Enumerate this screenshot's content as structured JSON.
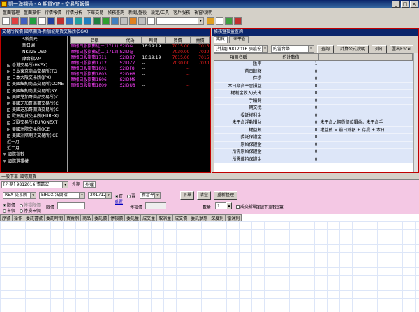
{
  "window": {
    "title": "凱一海期通 - A 期貨VIP - 交易所報價"
  },
  "menu": [
    "盤面管理",
    "盤面操作",
    "行情報價",
    "行情分析",
    "下單交易",
    "帳務查詢",
    "新聞/盤後",
    "設定/工具",
    "客戶服務",
    "視窗/說明"
  ],
  "left_panel": {
    "title": "交易所報價 國際期貨-新加坡期貨交易所(SGX)",
    "tree": [
      {
        "label": "S新美元",
        "level": 2,
        "expander": ""
      },
      {
        "label": "新日圓",
        "level": 2,
        "expander": ""
      },
      {
        "label": "NK225 USD",
        "level": 2,
        "expander": ""
      },
      {
        "label": "摩台指AM",
        "level": 2,
        "expander": ""
      },
      {
        "label": "香港交易所(HKEX)",
        "level": 1,
        "expander": "+"
      },
      {
        "label": "日本東京商品交易所(TO",
        "level": 1,
        "expander": "+"
      },
      {
        "label": "日本大阪交易所(JPX)",
        "level": 1,
        "expander": "+"
      },
      {
        "label": "美國紐約商品交易所(COME",
        "level": 1,
        "expander": "+"
      },
      {
        "label": "美國紐約商業交易所(NY",
        "level": 1,
        "expander": "+"
      },
      {
        "label": "美國芝加哥商品交易所(C",
        "level": 1,
        "expander": "+"
      },
      {
        "label": "美國芝加哥商業交易所(C",
        "level": 1,
        "expander": "+"
      },
      {
        "label": "美國芝加哥期貨交易所(C",
        "level": 1,
        "expander": "+"
      },
      {
        "label": "歐洲期貨交易所(EUREX)",
        "level": 1,
        "expander": "+"
      },
      {
        "label": "泛歐交易所(EURONEXT",
        "level": 1,
        "expander": "+"
      },
      {
        "label": "美國洲際交易所(ICE",
        "level": 1,
        "expander": "+"
      },
      {
        "label": "美國洲際期貨交易所(ICE",
        "level": 1,
        "expander": "+"
      },
      {
        "label": "近一月",
        "level": 1,
        "expander": ""
      },
      {
        "label": "近二月",
        "level": 1,
        "expander": ""
      },
      {
        "label": "國際指數",
        "level": 0,
        "expander": "+"
      },
      {
        "label": "國際選擇權",
        "level": 0,
        "expander": "+"
      }
    ],
    "columns": [
      "名稱",
      "代碼",
      "時間",
      "買價",
      "賣價"
    ],
    "rows": [
      {
        "name": "摩根日股指數近一(1711)",
        "code": "S2ID&",
        "time": "16:19:19",
        "buy": "7015.00",
        "sell": "7015"
      },
      {
        "name": "摩根日股指數近二(1712)",
        "code": "S2ID@",
        "time": "--",
        "buy": "7030.00",
        "sell": "7030"
      },
      {
        "name": "摩根日股指數1711",
        "code": "S2IDX7",
        "time": "16:19:19",
        "buy": "7015.00",
        "sell": "7015"
      },
      {
        "name": "摩根日股指數1712",
        "code": "S2IDZ7",
        "time": "--",
        "buy": "7030.00",
        "sell": "7030"
      },
      {
        "name": "摩根日股指數1801",
        "code": "S2IDF8",
        "time": "--",
        "buy": "--",
        "sell": ""
      },
      {
        "name": "摩根日股指數1803",
        "code": "S2IDH8",
        "time": "--",
        "buy": "--",
        "sell": ""
      },
      {
        "name": "摩根日股指數1806",
        "code": "S2IDM8",
        "time": "--",
        "buy": "--",
        "sell": ""
      },
      {
        "name": "摩根日股指數1809",
        "code": "S2IDU8",
        "time": "--",
        "buy": "--",
        "sell": ""
      }
    ]
  },
  "right_panel": {
    "title": "帳務暨損益查詢",
    "tabs": [
      "期貨",
      ".未平倉"
    ],
    "account_value": "[外期] 9812016 張嘉宏",
    "currency_value": "約當台幣",
    "buttons": [
      "查詢",
      "計算公式說明",
      "列印",
      "匯出Excel"
    ],
    "columns": [
      "項目名稱",
      "約計數值"
    ],
    "rows": [
      {
        "label": "匯率",
        "value": "1",
        "note": ""
      },
      {
        "label": "前日餘額",
        "value": "0",
        "note": ""
      },
      {
        "label": "存提",
        "value": "0",
        "note": ""
      },
      {
        "label": "本日期貨平倉損益",
        "value": "0",
        "note": ""
      },
      {
        "label": "權利金收入/支出",
        "value": "0",
        "note": ""
      },
      {
        "label": "手續費",
        "value": "0",
        "note": ""
      },
      {
        "label": "期交稅",
        "value": "0",
        "note": ""
      },
      {
        "label": "委託權利金",
        "value": "0",
        "note": ""
      },
      {
        "label": "未平倉浮動損益",
        "value": "0",
        "note": "未平倉之期貨部位損益，未平倉手"
      },
      {
        "label": "權益數",
        "value": "0",
        "note": "權益數 = 前日餘額 + 存提 + 本日"
      },
      {
        "label": "委託保證金",
        "value": "0",
        "note": ""
      },
      {
        "label": "原始保證金",
        "value": "0",
        "note": ""
      },
      {
        "label": "所需原始保證金",
        "value": "0",
        "note": ""
      },
      {
        "label": "所需維持保證金",
        "value": "0",
        "note": ""
      }
    ]
  },
  "order_panel": {
    "title": "一般下單-國際期貨",
    "account": "[外期] 9812016 張嘉宏",
    "tabs": [
      "外期",
      "外選"
    ],
    "exchange": "REX 交易所",
    "product": "EIFDX 法蘭指",
    "month": "201712",
    "side_buy": "買",
    "side_sell": "賣",
    "new_close": "新倉平",
    "price_type_limit": "限價",
    "price_type_market": "市價",
    "cond_touch": "停損限價",
    "cond_stop": "停損市價",
    "limit_label": "限價",
    "stop_label": "停損價",
    "qty_label": "數量",
    "qty_value": "1",
    "reset_label": "重置",
    "cancel_on_trade": "成交拆單",
    "confirm_label": "確認下單數",
    "count_value": "0筆",
    "buttons": [
      "下單",
      "清空",
      "重新整理"
    ],
    "grid_columns": [
      "序號",
      "操作",
      "委託書號",
      "委託時間",
      "買賣別",
      "商品",
      "委託價",
      "停損價",
      "委託量",
      "成交量",
      "取消量",
      "成交價",
      "委託狀態",
      "深度別",
      "當沖別"
    ]
  },
  "colors": {
    "title_blue": "#0a246a",
    "quote_name": "#ff40ff",
    "quote_price": "#ff2020",
    "order_bg": "#f4c8e4",
    "grid_row": "#dde6f8"
  }
}
